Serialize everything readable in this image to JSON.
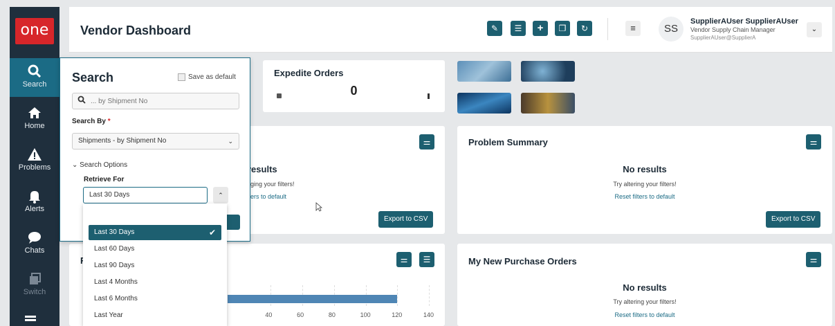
{
  "header": {
    "title": "Vendor Dashboard",
    "user_name": "SupplierAUser SupplierAUser",
    "user_role": "Vendor Supply Chain Manager",
    "user_email": "SupplierAUser@SupplierA",
    "avatar_initials": "SS"
  },
  "logo": "one",
  "sidebar": {
    "items": [
      {
        "label": "Search",
        "icon": "search-icon"
      },
      {
        "label": "Home",
        "icon": "home-icon"
      },
      {
        "label": "Problems",
        "icon": "warning-icon"
      },
      {
        "label": "Alerts",
        "icon": "bell-icon"
      },
      {
        "label": "Chats",
        "icon": "chat-icon"
      },
      {
        "label": "Switch",
        "icon": "switch-icon"
      }
    ]
  },
  "expedite": {
    "title": "Expedite Orders",
    "value": "0"
  },
  "search_panel": {
    "title": "Search",
    "save_default": "Save as default",
    "placeholder": "... by Shipment No",
    "search_by_label": "Search By",
    "required_mark": "*",
    "search_by_value": "Shipments - by Shipment No",
    "options_label": "Search Options",
    "retrieve_label": "Retrieve For",
    "retrieve_value": "Last 30 Days"
  },
  "dropdown": {
    "options": [
      "Last 30 Days",
      "Last 60 Days",
      "Last 90 Days",
      "Last 4 Months",
      "Last 6 Months",
      "Last Year"
    ],
    "selected": "Last 30 Days"
  },
  "left_card": {
    "results_partial": "results",
    "try_partial": "ging your filters!",
    "reset_partial": "ers to default",
    "export": "Export to CSV"
  },
  "problem_summary": {
    "title": "Problem Summary",
    "no_results": "No results",
    "try": "Try altering your filters!",
    "reset": "Reset filters to default",
    "export": "Export to CSV"
  },
  "bottom_left": {
    "title_partial": "F"
  },
  "purchase_orders": {
    "title": "My New Purchase Orders",
    "no_results": "No results",
    "try": "Try altering your filters!",
    "reset": "Reset filters to default"
  },
  "chart_data": {
    "type": "bar",
    "orientation": "horizontal",
    "xticks": [
      "40",
      "60",
      "80",
      "100",
      "120",
      "140"
    ],
    "values": [
      120
    ],
    "xlim": [
      0,
      140
    ]
  },
  "colors": {
    "accent": "#1d5f70",
    "brand": "#d7262a",
    "sidebar": "#1f2f3d",
    "bar": "#4f86b5"
  }
}
